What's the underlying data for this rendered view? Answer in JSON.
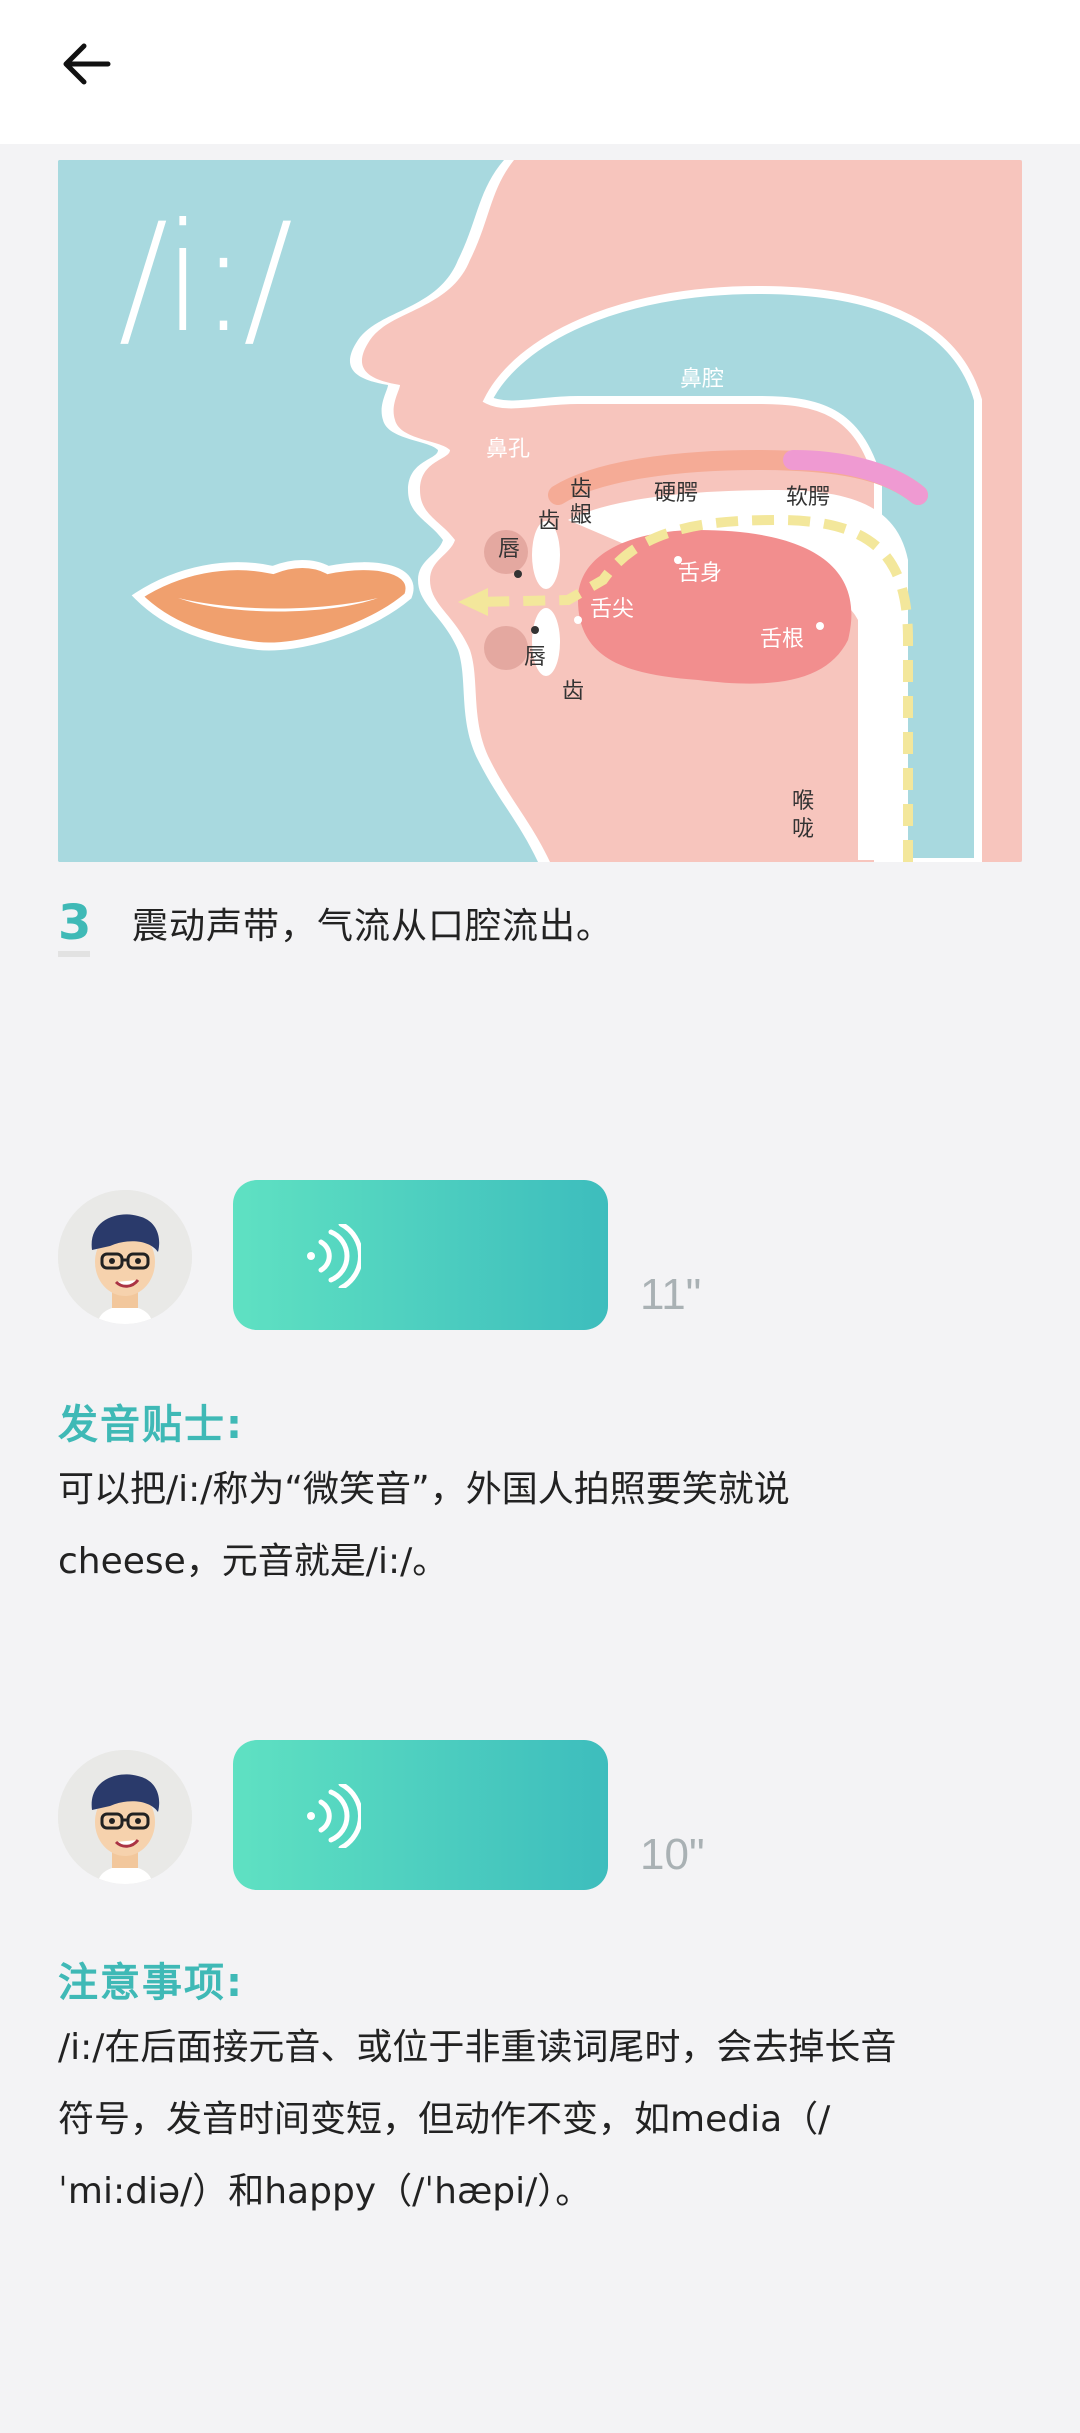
{
  "header": {
    "back_icon": "arrow-left-icon"
  },
  "diagram": {
    "phoneme": "/i:/",
    "labels": {
      "nasal_cavity": "鼻腔",
      "nostril": "鼻孔",
      "alveolar": "齿\n龈",
      "hard_palate": "硬腭",
      "soft_palate": "软腭",
      "upper_lip": "唇",
      "upper_teeth": "齿",
      "tongue_body": "舌身",
      "tongue_tip": "舌尖",
      "tongue_root": "舌根",
      "lower_lip": "唇",
      "lower_teeth": "齿",
      "throat": "喉\n咙"
    },
    "colors": {
      "background": "#a8d9df",
      "skin": "#f7c5bd",
      "tongue": "#f28e8e",
      "airflow": "#f3e79b"
    }
  },
  "step": {
    "number": "3",
    "text": "震动声带，气流从口腔流出。"
  },
  "audio1": {
    "duration": "11\""
  },
  "tip": {
    "title": "发音贴士:",
    "line1": "可以把/i:/称为“微笑音”，外国人拍照要笑就说",
    "line2": "cheese，元音就是/i:/。"
  },
  "audio2": {
    "duration": "10\""
  },
  "notice": {
    "title": "注意事项:",
    "line1": "/i:/在后面接元音、或位于非重读词尾时，会去掉长音",
    "line2": "符号，发音时间变短，但动作不变，如media（/",
    "line3": "ˈmi:diə/）和happy（/ˈhæpi/）。"
  },
  "accent": "#3fb9b6"
}
